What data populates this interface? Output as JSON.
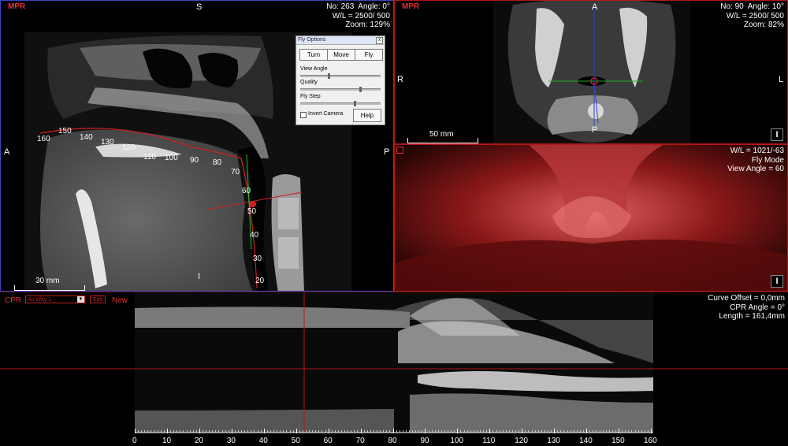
{
  "sagittal": {
    "mode": "MPR",
    "info": "No: 263  Angle: 0°\nW/L = 2500/ 500\nZoom: 129%",
    "orient_top": "S",
    "orient_left": "A",
    "orient_right": "P",
    "orient_bottom": "I",
    "scale": "30 mm",
    "ruler_labels": [
      "160",
      "150",
      "140",
      "130",
      "120",
      "110",
      "100",
      "90",
      "80",
      "70",
      "60",
      "50",
      "40",
      "30",
      "20"
    ]
  },
  "fly_options": {
    "title": "Fly Options",
    "close": "x",
    "turn": "Turn",
    "move": "Move",
    "fly": "Fly",
    "view_angle": "View Angle",
    "quality": "Quality",
    "fly_step": "Fly Step",
    "invert_camera": "Invert Camera",
    "help": "Help"
  },
  "axial": {
    "mode": "MPR",
    "info": "No: 90  Angle: 10°\nW/L = 2500/ 500\nZoom: 82%",
    "orient_top": "A",
    "orient_left": "R",
    "orient_right": "L",
    "orient_bottom": "P",
    "scale": "50 mm",
    "badge": "I"
  },
  "volume": {
    "info": "W/L = 1021/-63\nFly Mode\nView Angle = 60",
    "badge": "I"
  },
  "cpr": {
    "label": "CPR",
    "select_value": "Air Way 1",
    "edit": "Edit",
    "new": "New",
    "info": "Curve Offset = 0,0mm\nCPR Angle = 0°\nLength = 161,4mm",
    "ticks": [
      "0",
      "10",
      "20",
      "30",
      "40",
      "50",
      "60",
      "70",
      "80",
      "90",
      "100",
      "110",
      "120",
      "130",
      "140",
      "150",
      "160"
    ]
  },
  "colors": {
    "accent_red": "#e03030",
    "sagittal_border": "#3a46c8"
  }
}
